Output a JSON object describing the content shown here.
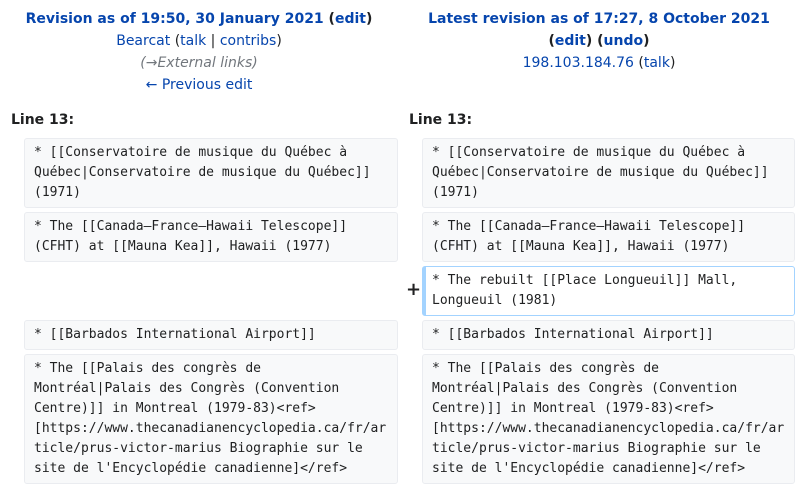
{
  "left": {
    "title": "Revision as of 19:50, 30 January 2021",
    "edit": "edit",
    "user": "Bearcat",
    "talk": "talk",
    "contribs": "contribs",
    "summary": "(→External links)",
    "prev": "← Previous edit",
    "line_label": "Line 13:"
  },
  "right": {
    "title": "Latest revision as of 17:27, 8 October 2021",
    "edit": "edit",
    "undo": "undo",
    "user": "198.103.184.76",
    "talk": "talk",
    "line_label": "Line 13:"
  },
  "diff": {
    "add_marker": "+",
    "left_lines": [
      "* [[Conservatoire de musique du Québec à\nQuébec|Conservatoire de musique du Québec]]\n(1971)",
      "* The [[Canada–France–Hawaii Telescope]]\n(CFHT) at [[Mauna Kea]], Hawaii (1977)",
      "* [[Barbados International Airport]]",
      "* The [[Palais des congrès de\nMontréal|Palais des Congrès (Convention\nCentre)]] in Montreal (1979-83)<ref>\n[https://www.thecanadianencyclopedia.ca/fr/ar\nticle/prus-victor-marius Biographie sur le\nsite de l'Encyclopédie canadienne]</ref>"
    ],
    "right_lines": [
      "* [[Conservatoire de musique du Québec à\nQuébec|Conservatoire de musique du Québec]]\n(1971)",
      "* The [[Canada–France–Hawaii Telescope]]\n(CFHT) at [[Mauna Kea]], Hawaii (1977)",
      "* The rebuilt [[Place Longueuil]] Mall,\nLongueuil (1981)",
      "* [[Barbados International Airport]]",
      "* The [[Palais des congrès de\nMontréal|Palais des Congrès (Convention\nCentre)]] in Montreal (1979-83)<ref>\n[https://www.thecanadianencyclopedia.ca/fr/ar\nticle/prus-victor-marius Biographie sur le\nsite de l'Encyclopédie canadienne]</ref>"
    ]
  }
}
